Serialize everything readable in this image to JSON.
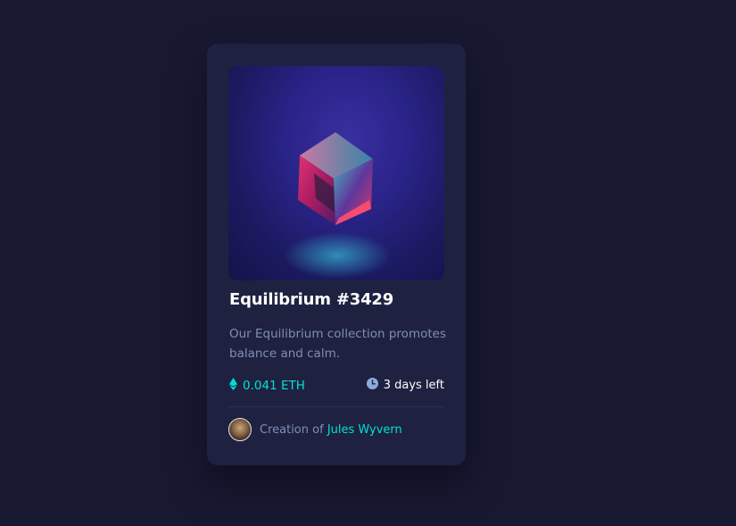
{
  "card": {
    "title": "Equilibrium #3429",
    "description": "Our Equilibrium collection promotes balance and calm.",
    "price": "0.041 ETH",
    "time_left": "3 days left",
    "creator_prefix": "Creation of",
    "creator_name": "Jules Wyvern"
  },
  "icons": {
    "price": "ethereum-icon",
    "time": "clock-icon"
  },
  "colors": {
    "background": "#181931",
    "card": "#1f2140",
    "accent": "#00e0d5",
    "muted_text": "#7e8fb4",
    "clock_icon": "#8bacd9"
  }
}
